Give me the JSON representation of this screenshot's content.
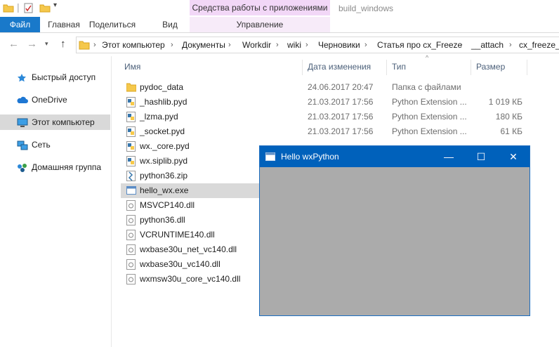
{
  "titlebar": {
    "context_tab": "Средства работы с приложениями",
    "window_title": "build_windows"
  },
  "ribbon": {
    "tabs": [
      {
        "label": "Файл"
      },
      {
        "label": "Главная"
      },
      {
        "label": "Поделиться"
      },
      {
        "label": "Вид"
      },
      {
        "label": "Управление"
      }
    ]
  },
  "address": {
    "crumbs": [
      "Этот компьютер",
      "Документы",
      "Workdir",
      "wiki",
      "Черновики",
      "Статья про cx_Freeze",
      "__attach",
      "cx_freeze_e"
    ]
  },
  "navpane": {
    "items": [
      {
        "label": "Быстрый доступ",
        "icon": "star-icon"
      },
      {
        "label": "OneDrive",
        "icon": "cloud-icon"
      },
      {
        "label": "Этот компьютер",
        "icon": "computer-icon"
      },
      {
        "label": "Сеть",
        "icon": "network-icon"
      },
      {
        "label": "Домашняя группа",
        "icon": "homegroup-icon"
      }
    ]
  },
  "columns": {
    "name": "Имя",
    "date": "Дата изменения",
    "type": "Тип",
    "size": "Размер"
  },
  "files": [
    {
      "name": "pydoc_data",
      "date": "24.06.2017 20:47",
      "type": "Папка с файлами",
      "size": "",
      "icon": "folder-icon"
    },
    {
      "name": "_hashlib.pyd",
      "date": "21.03.2017 17:56",
      "type": "Python Extension ...",
      "size": "1 019 КБ",
      "icon": "python-file-icon"
    },
    {
      "name": "_lzma.pyd",
      "date": "21.03.2017 17:56",
      "type": "Python Extension ...",
      "size": "180 КБ",
      "icon": "python-file-icon"
    },
    {
      "name": "_socket.pyd",
      "date": "21.03.2017 17:56",
      "type": "Python Extension ...",
      "size": "61 КБ",
      "icon": "python-file-icon"
    },
    {
      "name": "wx._core.pyd",
      "date": "",
      "type": "",
      "size": "",
      "icon": "python-file-icon"
    },
    {
      "name": "wx.siplib.pyd",
      "date": "",
      "type": "",
      "size": "",
      "icon": "python-file-icon"
    },
    {
      "name": "python36.zip",
      "date": "",
      "type": "",
      "size": "",
      "icon": "zip-file-icon"
    },
    {
      "name": "hello_wx.exe",
      "date": "",
      "type": "",
      "size": "",
      "icon": "exe-file-icon"
    },
    {
      "name": "MSVCP140.dll",
      "date": "",
      "type": "",
      "size": "",
      "icon": "dll-file-icon"
    },
    {
      "name": "python36.dll",
      "date": "",
      "type": "",
      "size": "",
      "icon": "dll-file-icon"
    },
    {
      "name": "VCRUNTIME140.dll",
      "date": "",
      "type": "",
      "size": "",
      "icon": "dll-file-icon"
    },
    {
      "name": "wxbase30u_net_vc140.dll",
      "date": "",
      "type": "",
      "size": "",
      "icon": "dll-file-icon"
    },
    {
      "name": "wxbase30u_vc140.dll",
      "date": "",
      "type": "",
      "size": "",
      "icon": "dll-file-icon"
    },
    {
      "name": "wxmsw30u_core_vc140.dll",
      "date": "",
      "type": "",
      "size": "",
      "icon": "dll-file-icon"
    }
  ],
  "wx_window": {
    "title": "Hello wxPython",
    "minimize": "—",
    "maximize": "☐",
    "close": "✕"
  },
  "colors": {
    "file_tab": "#1979ca",
    "context_tab": "#f2d7f7",
    "wx_titlebar": "#0061bb",
    "wx_client": "#ababab",
    "selection": "#d9d9d9"
  }
}
